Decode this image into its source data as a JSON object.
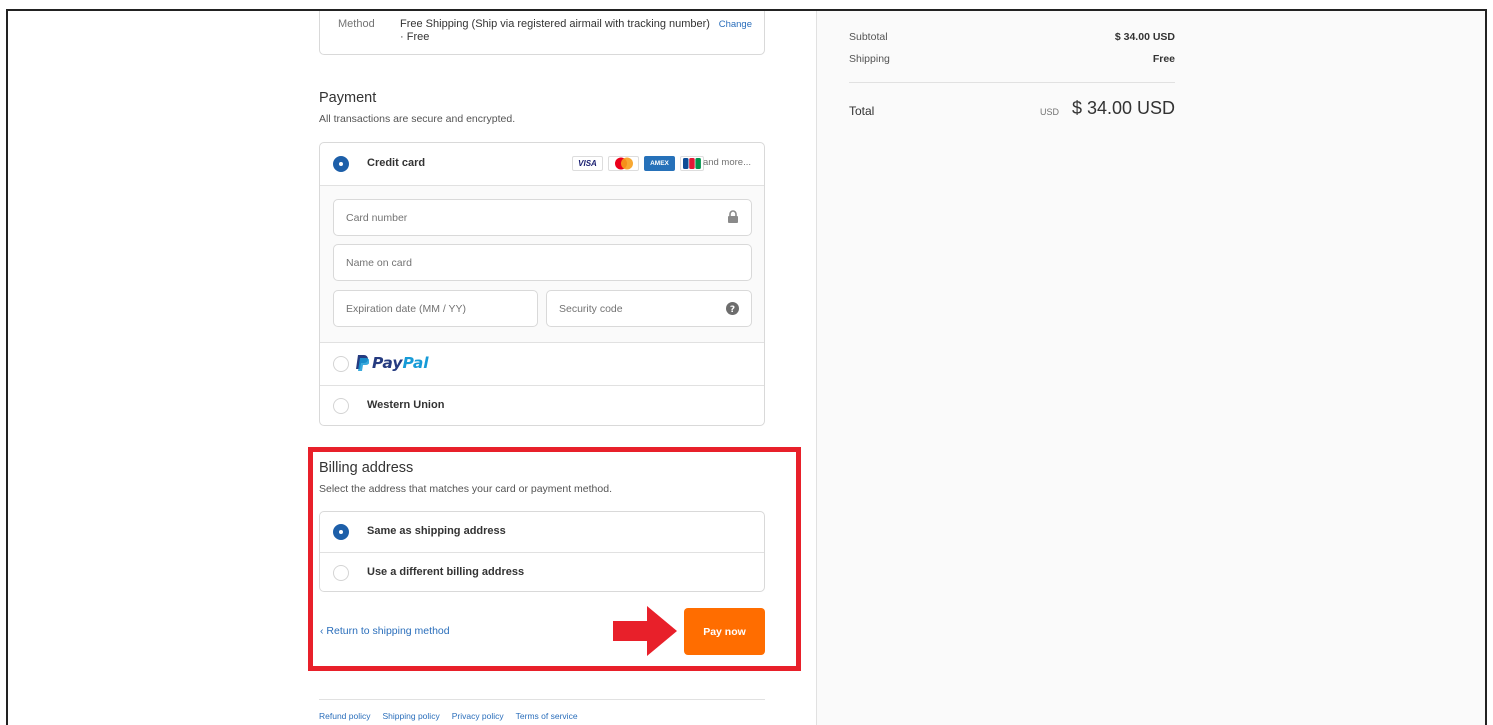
{
  "shipping": {
    "method_label": "Method",
    "method_value": "Free Shipping (Ship via registered airmail with tracking number)",
    "method_price": "· Free",
    "change_label": "Change"
  },
  "payment": {
    "title": "Payment",
    "subtitle": "All transactions are secure and encrypted.",
    "credit_card_label": "Credit card",
    "card_brands": [
      "VISA",
      "AMEX"
    ],
    "and_more": "and more...",
    "card_number_placeholder": "Card number",
    "name_placeholder": "Name on card",
    "expiry_placeholder": "Expiration date (MM / YY)",
    "security_placeholder": "Security code",
    "paypal_label_pay": "Pay",
    "paypal_label_pal": "Pal",
    "western_union_label": "Western Union",
    "selected": "credit_card",
    "colors": {
      "radio_selected": "#1d5fa9",
      "paypal_dark": "#253b80",
      "paypal_light": "#179bd7"
    }
  },
  "billing": {
    "title": "Billing address",
    "subtitle": "Select the address that matches your card or payment method.",
    "same_label": "Same as shipping address",
    "different_label": "Use a different billing address",
    "selected": "same"
  },
  "actions": {
    "return_label": "Return to shipping method",
    "pay_label": "Pay now",
    "pay_color": "#ff6d00",
    "highlight_color": "#e8202a"
  },
  "footer": {
    "links": [
      "Refund policy",
      "Shipping policy",
      "Privacy policy",
      "Terms of service"
    ]
  },
  "summary": {
    "subtotal_label": "Subtotal",
    "subtotal_value": "$ 34.00 USD",
    "shipping_label": "Shipping",
    "shipping_value": "Free",
    "total_label": "Total",
    "total_currency": "USD",
    "total_value": "$ 34.00 USD"
  }
}
